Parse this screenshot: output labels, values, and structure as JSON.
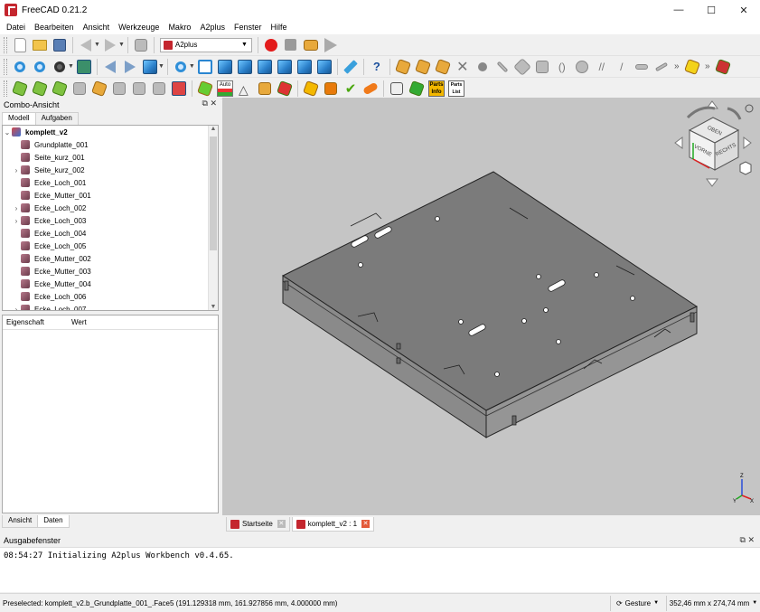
{
  "window": {
    "title": "FreeCAD 0.21.2",
    "minimize": "—",
    "maximize": "☐",
    "close": "✕"
  },
  "menu": [
    "Datei",
    "Bearbeiten",
    "Ansicht",
    "Werkzeuge",
    "Makro",
    "A2plus",
    "Fenster",
    "Hilfe"
  ],
  "toolbar": {
    "workbench": "A2plus",
    "auto_label": "Auto",
    "info_label": "Info",
    "parts_label": "Parts",
    "parts_list_label": "Parts List"
  },
  "combo": {
    "title": "Combo-Ansicht",
    "controls": "⧉ ✕",
    "tab_model": "Modell",
    "tab_tasks": "Aufgaben",
    "tab_view": "Ansicht",
    "tab_data": "Daten",
    "root": "komplett_v2",
    "items": [
      {
        "label": "Grundplatte_001",
        "expand": ""
      },
      {
        "label": "Seite_kurz_001",
        "expand": ""
      },
      {
        "label": "Seite_kurz_002",
        "expand": "›"
      },
      {
        "label": "Ecke_Loch_001",
        "expand": ""
      },
      {
        "label": "Ecke_Mutter_001",
        "expand": ""
      },
      {
        "label": "Ecke_Loch_002",
        "expand": "›"
      },
      {
        "label": "Ecke_Loch_003",
        "expand": "›"
      },
      {
        "label": "Ecke_Loch_004",
        "expand": ""
      },
      {
        "label": "Ecke_Loch_005",
        "expand": ""
      },
      {
        "label": "Ecke_Mutter_002",
        "expand": ""
      },
      {
        "label": "Ecke_Mutter_003",
        "expand": ""
      },
      {
        "label": "Ecke_Mutter_004",
        "expand": ""
      },
      {
        "label": "Ecke_Loch_006",
        "expand": ""
      },
      {
        "label": "Ecke_Loch_007",
        "expand": "›"
      }
    ],
    "prop_col": "Eigenschaft",
    "val_col": "Wert"
  },
  "view": {
    "navcube": {
      "top": "OBEN",
      "front": "VORNE",
      "right": "RECHTS"
    },
    "axis": {
      "x": "X",
      "y": "Y",
      "z": "Z"
    },
    "tabs": [
      {
        "label": "Startseite",
        "active": false
      },
      {
        "label": "komplett_v2 : 1",
        "active": true
      }
    ]
  },
  "output": {
    "title": "Ausgabefenster",
    "controls": "⧉ ✕",
    "lines": [
      "08:54:27  Initializing A2plus Workbench v0.4.65."
    ]
  },
  "status": {
    "message": "Preselected: komplett_v2.b_Grundplatte_001_.Face5 (191.129318 mm, 161.927856 mm, 4.000000 mm)",
    "nav_style": "Gesture",
    "dimensions": "352,46 mm x 274,74 mm"
  }
}
